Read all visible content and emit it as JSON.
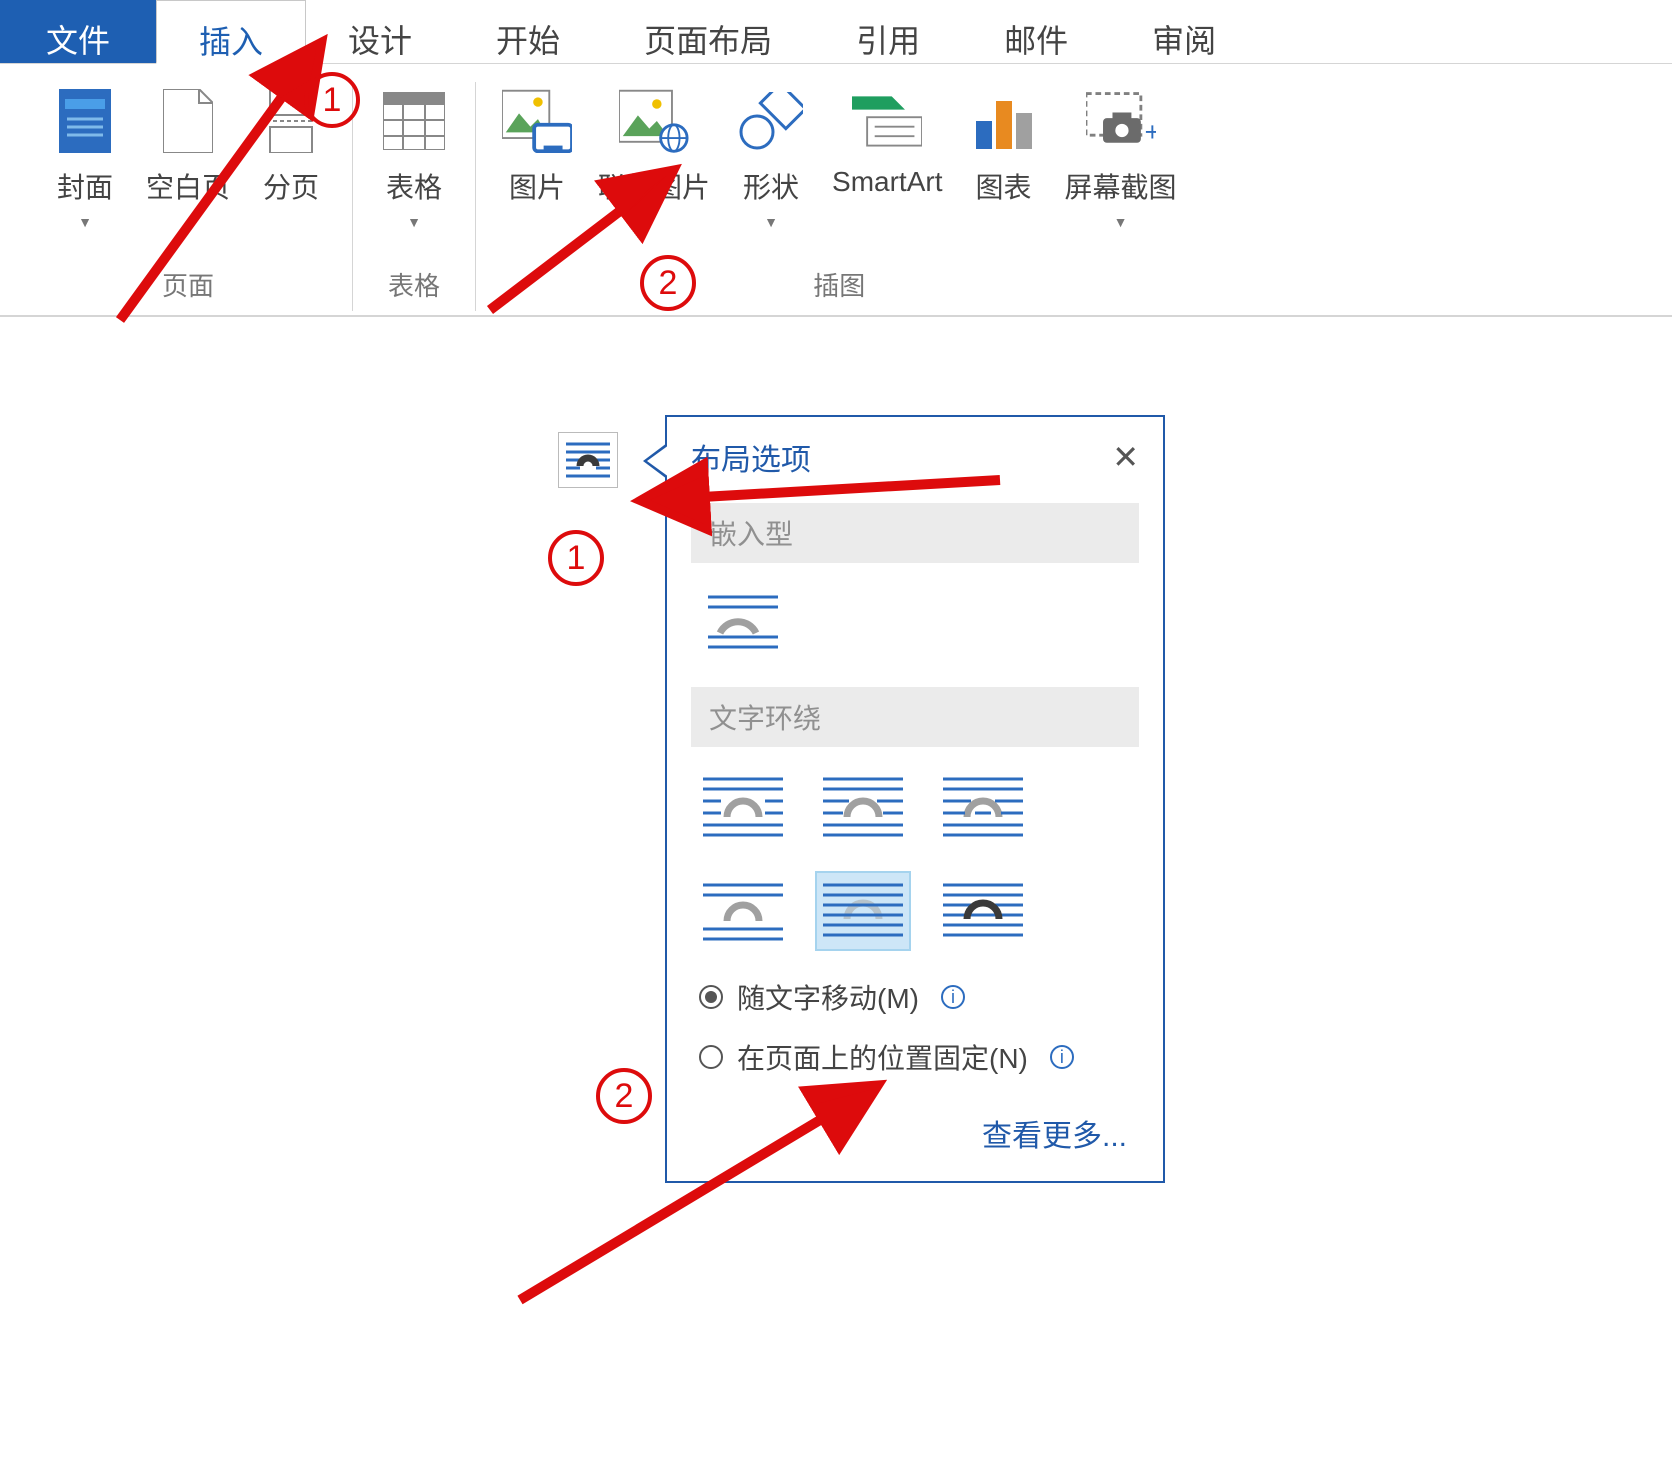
{
  "tabs": {
    "file": "文件",
    "insert": "插入",
    "design": "设计",
    "home": "开始",
    "layout": "页面布局",
    "references": "引用",
    "mailings": "邮件",
    "review": "审阅"
  },
  "ribbon": {
    "cover": "封面",
    "blank_page": "空白页",
    "page_break": "分页",
    "table": "表格",
    "picture": "图片",
    "online_picture": "联机图片",
    "shapes": "形状",
    "smartart": "SmartArt",
    "chart": "图表",
    "screenshot": "屏幕截图"
  },
  "groups": {
    "pages": "页面",
    "tables": "表格",
    "illustrations": "插图"
  },
  "popup": {
    "title": "布局选项",
    "inline": "嵌入型",
    "text_wrapping": "文字环绕",
    "move_with_text": "随文字移动(M)",
    "fix_position": "在页面上的位置固定(N)",
    "see_more": "查看更多..."
  },
  "annotations": {
    "one": "1",
    "two": "2"
  }
}
